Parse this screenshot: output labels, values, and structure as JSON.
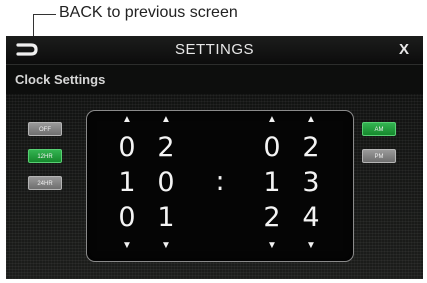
{
  "annotation": {
    "text": "BACK to previous screen"
  },
  "topbar": {
    "back_icon": "back-arrow-icon",
    "title": "SETTINGS",
    "close_label": "X"
  },
  "section": {
    "title": "Clock Settings"
  },
  "format_buttons": [
    {
      "label": "OFF",
      "state": "inactive"
    },
    {
      "label": "12HR",
      "state": "active"
    },
    {
      "label": "24HR",
      "state": "inactive"
    }
  ],
  "ampm_buttons": [
    {
      "label": "AM",
      "state": "active"
    },
    {
      "label": "PM",
      "state": "inactive"
    }
  ],
  "time_picker": {
    "arrow_up": "▲",
    "arrow_down": "▼",
    "separator": ":",
    "columns": [
      {
        "role": "hour-tens",
        "digits": [
          "0",
          "1",
          "0"
        ]
      },
      {
        "role": "hour-ones",
        "digits": [
          "2",
          "0",
          "1"
        ]
      },
      {
        "role": "minute-tens",
        "digits": [
          "0",
          "1",
          "2"
        ]
      },
      {
        "role": "minute-ones",
        "digits": [
          "2",
          "3",
          "4"
        ]
      }
    ]
  },
  "colors": {
    "active_button": "#15882c",
    "inactive_button": "#7a7a7a",
    "screen_background": "#0d0e0d",
    "text": "#f4f4f4"
  }
}
